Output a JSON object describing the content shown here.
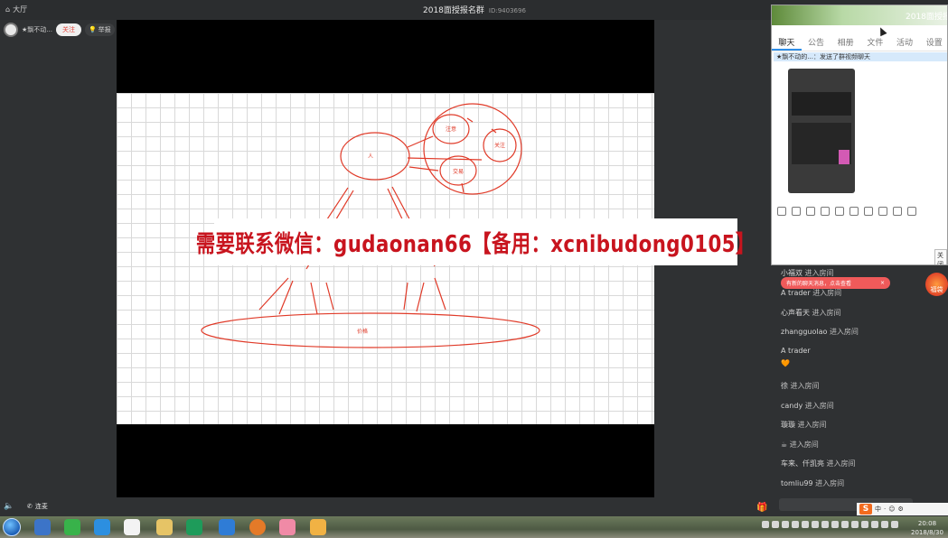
{
  "app": {
    "home_label": "大厅",
    "room_title": "2018面授报名群",
    "room_id": "ID:9403696"
  },
  "user": {
    "name": "★飘不动...",
    "follow_label": "关注",
    "report_label": "举报"
  },
  "whiteboard": {
    "node_person": "人",
    "node_focus": "注意",
    "node_attention": "关注",
    "node_trade": "交易",
    "node_price": "价格"
  },
  "banner": {
    "text": "需要联系微信：gudaonan66【备用：xcnibudong0105】"
  },
  "controls": {
    "mic_label": "连麦"
  },
  "chat_window": {
    "title": "2018面授报",
    "tabs": [
      "聊天",
      "公告",
      "相册",
      "文件",
      "活动",
      "设置"
    ],
    "active_tab": 0,
    "highlight_line": "★飘不动的...：发送了群视频聊天",
    "close_label": "关闭"
  },
  "chat_feed": {
    "notification": "有新的聊天消息，点击查看",
    "gift_badge_label": "福袋",
    "entries": [
      {
        "user": "小福双",
        "action": "进入房间"
      },
      {
        "user": "A trader",
        "action": "进入房间"
      },
      {
        "user": "心声看天",
        "action": "进入房间"
      },
      {
        "user": "zhangguolao",
        "action": "进入房间"
      },
      {
        "user": "A trader",
        "action": ""
      },
      {
        "user": "🧡",
        "action": ""
      },
      {
        "user": "徐",
        "action": "进入房间"
      },
      {
        "user": "candy",
        "action": "进入房间"
      },
      {
        "user": "璇璇",
        "action": "进入房间"
      },
      {
        "user": "☕",
        "action": "进入房间"
      },
      {
        "user": "车来、仟凯亮",
        "action": "进入房间"
      },
      {
        "user": "tomliu99",
        "action": "进入房间"
      }
    ]
  },
  "taskbar": {
    "time": "20:08",
    "date": "2018/8/30"
  },
  "colors": {
    "background": "#2f3133",
    "accent_red": "#c8141e",
    "board_ink": "#e03a28"
  }
}
